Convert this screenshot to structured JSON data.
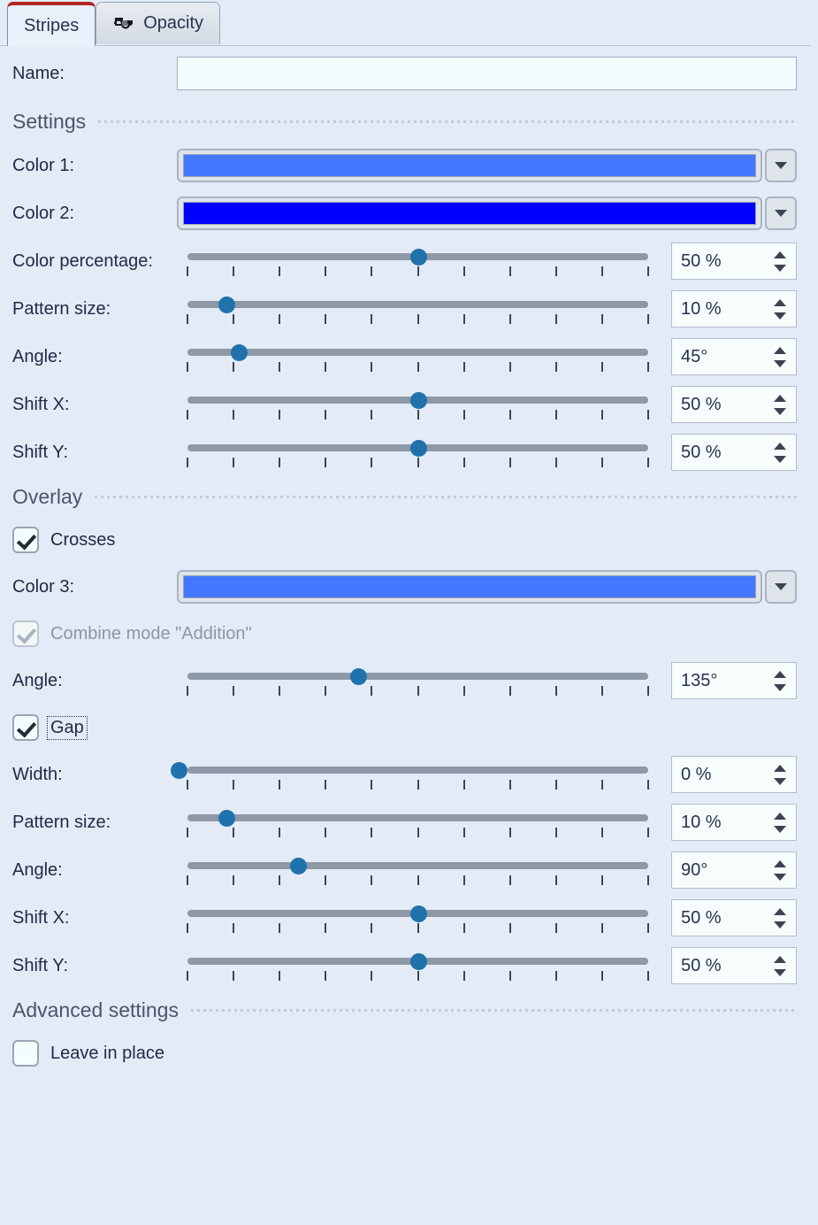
{
  "tabs": [
    {
      "label": "Stripes",
      "icon": "",
      "active": true
    },
    {
      "label": "Opacity",
      "icon": "opacity-icon",
      "active": false
    }
  ],
  "name_row": {
    "label": "Name:",
    "value": "",
    "placeholder": ""
  },
  "sections": {
    "settings": "Settings",
    "overlay": "Overlay",
    "advanced": "Advanced settings"
  },
  "colors": {
    "color1": {
      "label": "Color 1:",
      "hex": "#4477ff"
    },
    "color2": {
      "label": "Color 2:",
      "hex": "#0000ff"
    },
    "color3": {
      "label": "Color 3:",
      "hex": "#4477ff"
    }
  },
  "settings_sliders": [
    {
      "label": "Color percentage:",
      "value": "50 %",
      "pos": 50
    },
    {
      "label": "Pattern size:",
      "value": "10 %",
      "pos": 10
    },
    {
      "label": "Angle:",
      "value": "45°",
      "pos": 12.5
    },
    {
      "label": "Shift X:",
      "value": "50 %",
      "pos": 50
    },
    {
      "label": "Shift Y:",
      "value": "50 %",
      "pos": 50
    }
  ],
  "overlay": {
    "crosses": {
      "label": "Crosses",
      "checked": true,
      "disabled": false,
      "focused": false
    },
    "combine": {
      "label": "Combine mode \"Addition\"",
      "checked": true,
      "disabled": true,
      "focused": false
    },
    "gap": {
      "label": "Gap",
      "checked": true,
      "disabled": false,
      "focused": true
    },
    "angle_slider": {
      "label": "Angle:",
      "value": "135°",
      "pos": 37.5
    },
    "gap_sliders": [
      {
        "label": "Width:",
        "value": "0 %",
        "pos": 0
      },
      {
        "label": "Pattern size:",
        "value": "10 %",
        "pos": 10
      },
      {
        "label": "Angle:",
        "value": "90°",
        "pos": 25
      },
      {
        "label": "Shift X:",
        "value": "50 %",
        "pos": 50
      },
      {
        "label": "Shift Y:",
        "value": "50 %",
        "pos": 50
      }
    ]
  },
  "advanced": {
    "leave_in_place": {
      "label": "Leave in place",
      "checked": false,
      "disabled": false,
      "focused": false
    }
  },
  "theme": {
    "background": "#e3ebf7",
    "accent_red": "#b22626",
    "slider_handle": "#1f72ab",
    "slider_track": "#8e99a8",
    "label_text": "#1f2a44"
  }
}
